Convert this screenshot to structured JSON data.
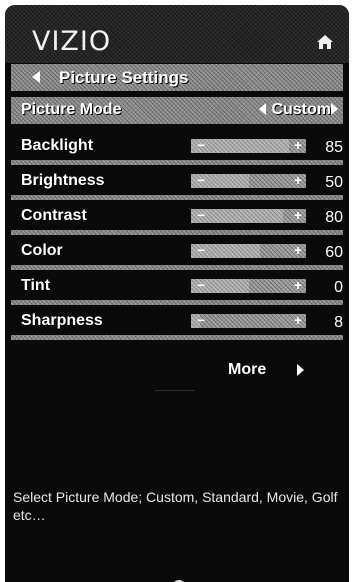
{
  "brand": {
    "logo_text": "VIZIO"
  },
  "nav": {
    "home_icon": "home-icon",
    "back_icon": "left-triangle-icon"
  },
  "header": {
    "title": "Picture Settings"
  },
  "picture_mode": {
    "label": "Picture Mode",
    "value": "Custom",
    "options_shown": [
      "Custom"
    ]
  },
  "settings": [
    {
      "label": "Backlight",
      "value": "85",
      "level": 85,
      "max": 100
    },
    {
      "label": "Brightness",
      "value": "50",
      "level": 50,
      "max": 100
    },
    {
      "label": "Contrast",
      "value": "80",
      "level": 80,
      "max": 100
    },
    {
      "label": "Color",
      "value": "60",
      "level": 60,
      "max": 100
    },
    {
      "label": "Tint",
      "value": "0",
      "level": 0,
      "min": -50,
      "max": 50
    },
    {
      "label": "Sharpness",
      "value": "8",
      "level": 8,
      "max": 100
    }
  ],
  "slider_symbols": {
    "minus": "−",
    "plus": "+"
  },
  "more": {
    "label": "More"
  },
  "help_text": "Select Picture Mode; Custom, Standard, Movie, Golf etc…",
  "colors": {
    "background": "#0a0a0a",
    "highlight": "#8c8c8c",
    "text": "#ffffff"
  }
}
